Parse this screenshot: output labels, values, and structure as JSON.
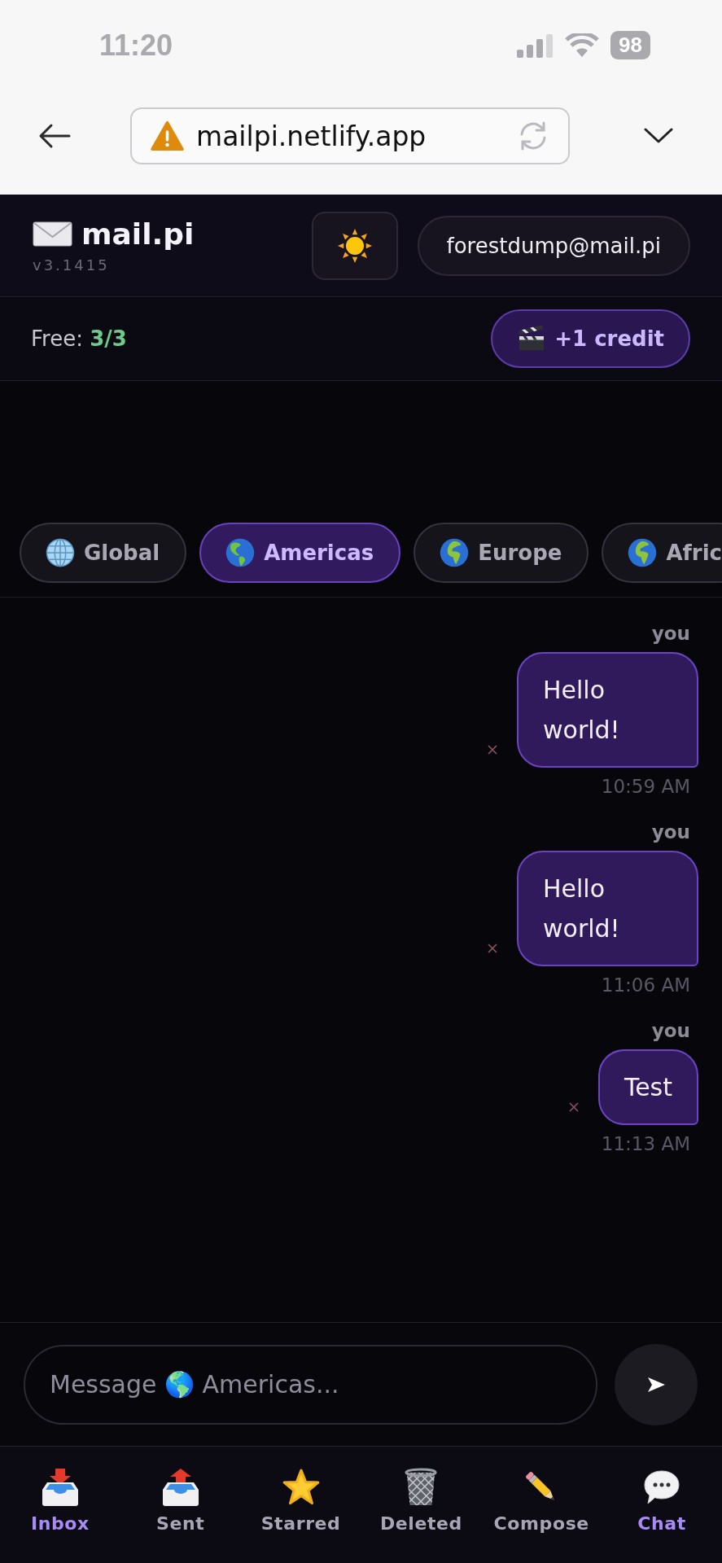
{
  "status_bar": {
    "time": "11:20",
    "battery": "98"
  },
  "browser": {
    "url": "mailpi.netlify.app"
  },
  "header": {
    "app_name": "mail.pi",
    "version": "v3.1415",
    "account": "forestdump@mail.pi"
  },
  "credits": {
    "quota": "Free: **3/3**",
    "button": "+1 credit"
  },
  "regions": [
    {
      "label": "Global",
      "kind": "meridian",
      "selected": false
    },
    {
      "label": "Americas",
      "kind": "americas",
      "selected": true
    },
    {
      "label": "Europe",
      "kind": "europe_africa",
      "selected": false
    },
    {
      "label": "Afric",
      "kind": "europe_africa",
      "selected": false
    }
  ],
  "messages": [
    {
      "author": "you",
      "text": "Hello world!",
      "time": "10:59 AM"
    },
    {
      "author": "you",
      "text": "Hello world!",
      "time": "11:06 AM"
    },
    {
      "author": "you",
      "text": "Test",
      "time": "11:13 AM"
    }
  ],
  "composer": {
    "placeholder": "Message 🌎 Americas..."
  },
  "nav": [
    {
      "label": "Inbox",
      "kind": "inbox",
      "selected": true
    },
    {
      "label": "Sent",
      "kind": "sent",
      "selected": false
    },
    {
      "label": "Starred",
      "kind": "starred",
      "selected": false
    },
    {
      "label": "Deleted",
      "kind": "deleted",
      "selected": false
    },
    {
      "label": "Compose",
      "kind": "compose",
      "selected": false
    },
    {
      "label": "Chat",
      "kind": "chat",
      "selected": true
    }
  ]
}
